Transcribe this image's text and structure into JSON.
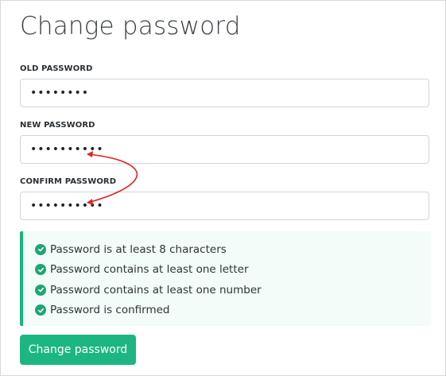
{
  "page": {
    "title": "Change password"
  },
  "form": {
    "old_password": {
      "label": "OLD PASSWORD",
      "value": "••••••••"
    },
    "new_password": {
      "label": "NEW PASSWORD",
      "value": "••••••••••"
    },
    "confirm_password": {
      "label": "CONFIRM PASSWORD",
      "value": "••••••••••"
    }
  },
  "validation": {
    "rules": [
      {
        "text": "Password is at least 8 characters",
        "status": "check-circle-icon"
      },
      {
        "text": "Password contains at least one letter",
        "status": "check-circle-icon"
      },
      {
        "text": "Password contains at least one number",
        "status": "check-circle-icon"
      },
      {
        "text": "Password is confirmed",
        "status": "check-circle-icon"
      }
    ]
  },
  "actions": {
    "submit_label": "Change password"
  },
  "colors": {
    "accent": "#1cb682",
    "success_bg": "#f3fcf8",
    "annotation_arrow": "#e02424"
  }
}
